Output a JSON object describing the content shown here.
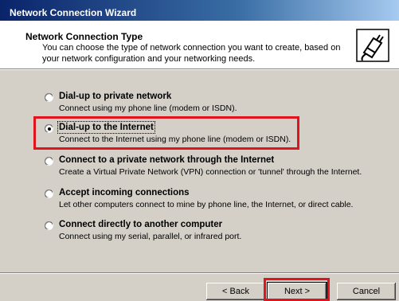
{
  "window": {
    "title": "Network Connection Wizard"
  },
  "header": {
    "title": "Network Connection Type",
    "subtitle": "You can choose the type of network connection you want to create, based on your network configuration and your networking needs."
  },
  "options": [
    {
      "label": "Dial-up to private network",
      "description": "Connect using my phone line (modem or ISDN).",
      "selected": false
    },
    {
      "label": "Dial-up to the Internet",
      "description": "Connect to the Internet using my phone line (modem or ISDN).",
      "selected": true
    },
    {
      "label": "Connect to a private network through the Internet",
      "description": "Create a Virtual Private Network (VPN) connection or 'tunnel' through the Internet.",
      "selected": false
    },
    {
      "label": "Accept incoming connections",
      "description": "Let other computers connect to mine by phone line, the Internet, or direct cable.",
      "selected": false
    },
    {
      "label": "Connect directly to another computer",
      "description": "Connect using my serial, parallel, or infrared port.",
      "selected": false
    }
  ],
  "buttons": {
    "back": "< Back",
    "next": "Next >",
    "cancel": "Cancel"
  },
  "colors": {
    "highlight": "#e0141e",
    "titlebar": "#0a246a",
    "dialog": "#d4d0c8"
  },
  "icons": {
    "header_icon": "network-plug-icon"
  }
}
